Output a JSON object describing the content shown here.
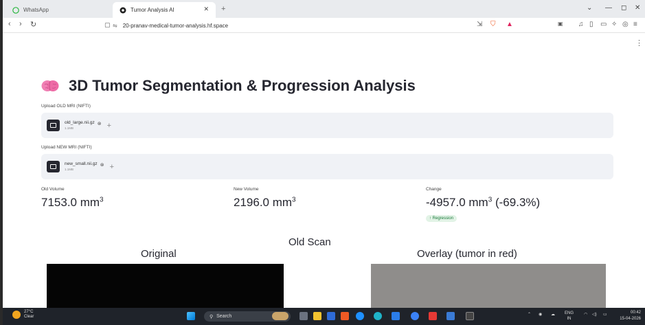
{
  "browser": {
    "tabs": [
      {
        "label": "WhatsApp",
        "active": false
      },
      {
        "label": "Tumor Analysis AI",
        "active": true
      }
    ],
    "url": "20-pranav-medical-tumor-analysis.hf.space"
  },
  "page": {
    "title": "3D Tumor Segmentation & Progression Analysis",
    "old_upload": {
      "label": "Upload OLD MRI (NIFTI)",
      "file_name": "old_large.nii.gz",
      "file_size": "1.1MB"
    },
    "new_upload": {
      "label": "Upload NEW MRI (NIFTI)",
      "file_name": "new_small.nii.gz",
      "file_size": "1.1MB"
    },
    "metrics": [
      {
        "label": "Old Volume",
        "value": "7153.0 mm",
        "sup": "3",
        "suffix": ""
      },
      {
        "label": "New Volume",
        "value": "2196.0 mm",
        "sup": "3",
        "suffix": ""
      },
      {
        "label": "Change",
        "value": "-4957.0 mm",
        "sup": "3",
        "suffix": " (-69.3%)",
        "delta": "↑ Regression"
      }
    ],
    "scan_title": "Old Scan",
    "panels": [
      {
        "title": "Original"
      },
      {
        "title": "Overlay (tumor in red)"
      }
    ]
  },
  "taskbar": {
    "weather_temp": "27°C",
    "weather_desc": "Clear",
    "search_placeholder": "Search",
    "lang": "ENG",
    "region": "IN",
    "time": "00:42",
    "date": "15-04-2026"
  },
  "colors": {
    "accent_green": "#1a7a3a",
    "brave_orange": "#f05a24",
    "text_dark": "#262730",
    "uploader_bg": "#f0f2f6"
  }
}
